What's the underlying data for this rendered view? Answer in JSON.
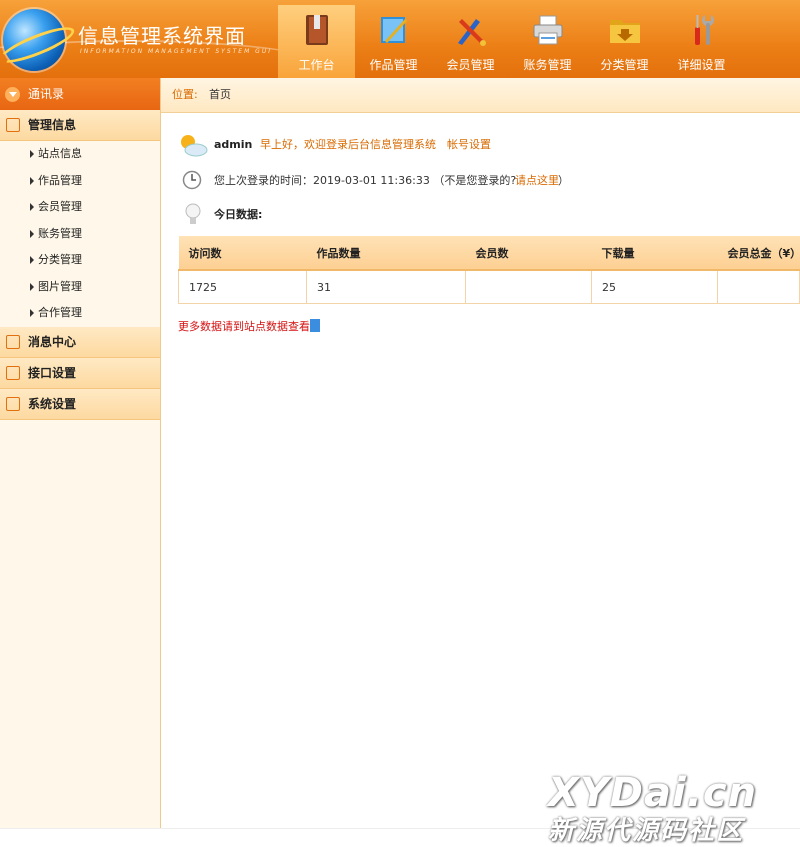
{
  "header": {
    "title": "信息管理系统界面",
    "subtitle": "INFORMATION MANAGEMENT SYSTEM GUI",
    "nav": [
      {
        "label": "工作台",
        "icon": "book-icon",
        "active": true
      },
      {
        "label": "作品管理",
        "icon": "ruler-icon",
        "active": false
      },
      {
        "label": "会员管理",
        "icon": "pencil-brush-icon",
        "active": false
      },
      {
        "label": "账务管理",
        "icon": "printer-icon",
        "active": false
      },
      {
        "label": "分类管理",
        "icon": "folder-icon",
        "active": false
      },
      {
        "label": "详细设置",
        "icon": "tools-icon",
        "active": false
      }
    ]
  },
  "sidebar": {
    "top_label": "通讯录",
    "groups": [
      {
        "label": "管理信息",
        "items": [
          "站点信息",
          "作品管理",
          "会员管理",
          "账务管理",
          "分类管理",
          "图片管理",
          "合作管理"
        ]
      },
      {
        "label": "消息中心"
      },
      {
        "label": "接口设置"
      },
      {
        "label": "系统设置"
      }
    ]
  },
  "breadcrumb": {
    "label": "位置:",
    "current": "首页"
  },
  "main": {
    "username": "admin",
    "welcome": "早上好，欢迎登录后台信息管理系统",
    "account_link": "帐号设置",
    "last_login": "您上次登录的时间：2019-03-01 11:36:33 （不是您登录的?",
    "click_here": "请点这里",
    "paren_close": "）",
    "today_label": "今日数据:",
    "table": {
      "headers": [
        "访问数",
        "作品数量",
        "会员数",
        "下载量",
        "会员总金（¥）"
      ],
      "rows": [
        [
          "1725",
          "31",
          "",
          "25",
          ""
        ]
      ]
    },
    "more_link": "更多数据请到站点数据查看"
  },
  "watermark": {
    "line1": "XYDai.cn",
    "line2": "新源代源码社区"
  },
  "colors": {
    "header_orange": "#ec7f16",
    "accent_text": "#d86a00",
    "link_red": "#d41212"
  }
}
